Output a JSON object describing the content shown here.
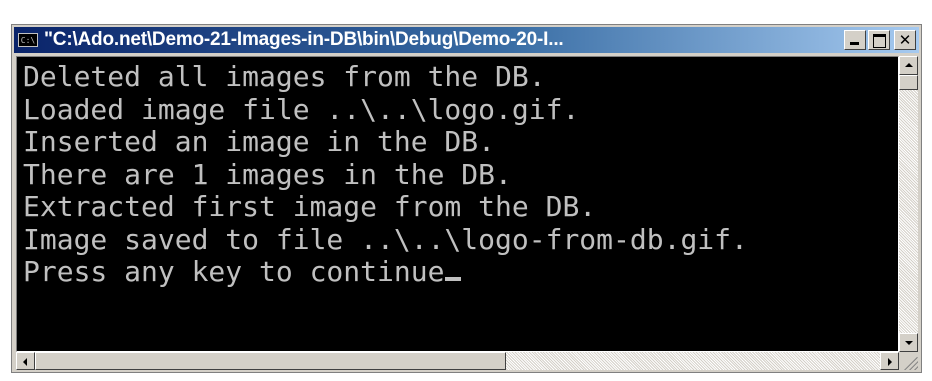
{
  "window": {
    "title": "\"C:\\Ado.net\\Demo-21-Images-in-DB\\bin\\Debug\\Demo-20-I...",
    "icon_label": "C:\\",
    "icon": "console-app-icon",
    "titlebar_color": "#0a246a"
  },
  "caption_buttons": {
    "minimize": "minimize-icon",
    "maximize": "maximize-icon",
    "close_label": "✕"
  },
  "console": {
    "background": "#000000",
    "foreground": "#c0c0c0",
    "lines": [
      "Deleted all images from the DB.",
      "Loaded image file ..\\..\\logo.gif.",
      "Inserted an image in the DB.",
      "There are 1 images in the DB.",
      "Extracted first image from the DB.",
      "Image saved to file ..\\..\\logo-from-db.gif.",
      "Press any key to continue"
    ],
    "cursor": "blinking-underscore-cursor"
  },
  "scrollbars": {
    "vertical_position": 0,
    "horizontal_position": 0
  }
}
